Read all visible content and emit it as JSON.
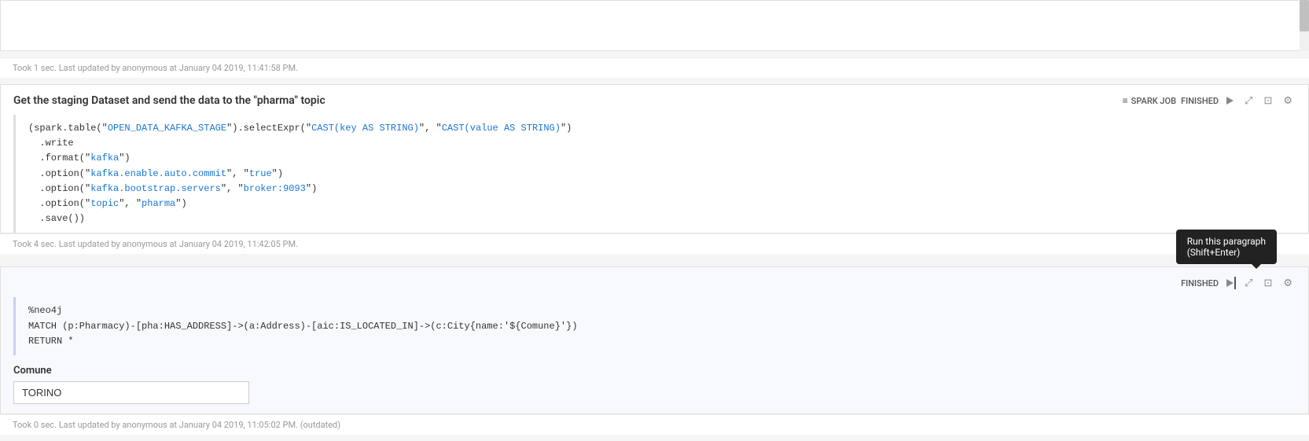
{
  "topCell": {
    "statusBar": "Took 1 sec. Last updated by anonymous at January 04 2019, 11:41:58 PM."
  },
  "sparkCell": {
    "title": "Get the staging Dataset and send the data to the \"pharma\" topic",
    "badge": "SPARK JOB",
    "status": "FINISHED",
    "code": {
      "line1_pre": "(spark.table(\"",
      "line1_table": "OPEN_DATA_KAFKA_STAGE",
      "line1_mid": "\").selectExpr(\"",
      "line1_cast1": "CAST(key AS STRING)",
      "line1_mid2": "\", \"",
      "line1_cast2": "CAST(value AS STRING)",
      "line1_end": "\")",
      "line2": "  .write",
      "line3_pre": "  .format(\"",
      "line3_val": "kafka",
      "line3_end": "\")",
      "line4_pre": "  .option(\"",
      "line4_key": "kafka.enable.auto.commit",
      "line4_mid": "\", \"",
      "line4_val": "true",
      "line4_end": "\")",
      "line5_pre": "  .option(\"",
      "line5_key": "kafka.bootstrap.servers",
      "line5_mid": "\", \"",
      "line5_val": "broker:9093",
      "line5_end": "\")",
      "line6_pre": "  .option(\"",
      "line6_key": "topic",
      "line6_mid": "\", \"",
      "line6_val": "pharma",
      "line6_end": "\")",
      "line7": "  .save())"
    },
    "statusBar": "Took 4 sec. Last updated by anonymous at January 04 2019, 11:42:05 PM."
  },
  "neo4jCell": {
    "status": "FINISHED",
    "code": {
      "line1": "%neo4j",
      "line2": "MATCH (p:Pharmacy)-[pha:HAS_ADDRESS]->(a:Address)-[aic:IS_LOCATED_IN]->(c:City{name:'${Comune}'})",
      "line3": "RETURN *"
    },
    "widget": {
      "label": "Comune",
      "inputValue": "TORINO",
      "inputPlaceholder": ""
    },
    "statusBar": "Took 0 sec. Last updated by anonymous at January 04 2019, 11:05:02 PM. (outdated)",
    "tooltip": {
      "line1": "Run this paragraph",
      "line2": "(Shift+Enter)"
    }
  },
  "icons": {
    "sparkJobIcon": "≡",
    "playIcon": "▶",
    "expandIcon": "⤢",
    "settingsIcon": "⚙",
    "bookmarkIcon": "⬜",
    "runTooltip": "▶"
  }
}
